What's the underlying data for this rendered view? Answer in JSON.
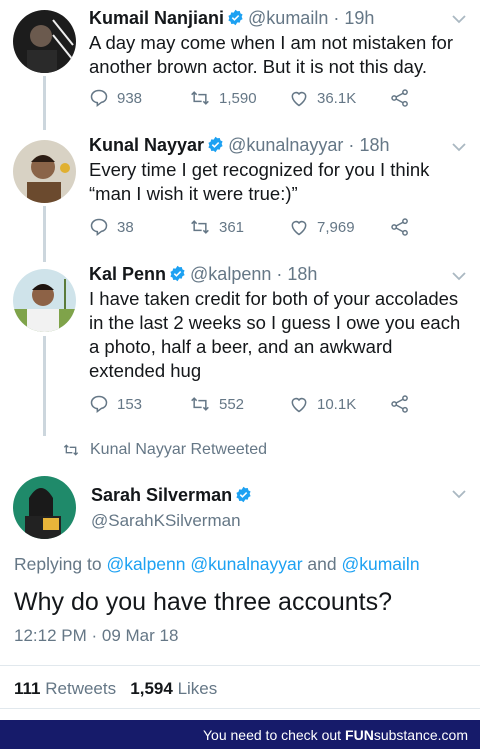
{
  "tweets": [
    {
      "name": "Kumail Nanjiani",
      "handle": "@kumailn",
      "sep": "·",
      "time": "19h",
      "text_lines": [
        "A day may come when I am not mistaken for",
        "another brown actor. But it is not this day."
      ],
      "replies": "938",
      "retweets": "1,590",
      "likes": "36.1K"
    },
    {
      "name": "Kunal Nayyar",
      "handle": "@kunalnayyar",
      "sep": "·",
      "time": "18h",
      "text_lines": [
        "Every time I get recognized for you I think",
        "“man I wish it were true:)”"
      ],
      "replies": "38",
      "retweets": "361",
      "likes": "7,969"
    },
    {
      "name": "Kal Penn",
      "handle": "@kalpenn",
      "sep": "·",
      "time": "18h",
      "text_lines": [
        "I have taken credit for both of your accolades",
        "in the last 2 weeks so I guess I owe you each",
        "a photo, half a beer, and an awkward",
        "extended hug"
      ],
      "replies": "153",
      "retweets": "552",
      "likes": "10.1K"
    }
  ],
  "retweeted_label": "Kunal Nayyar Retweeted",
  "main_tweet": {
    "name": "Sarah Silverman",
    "handle": "@SarahKSilverman",
    "replying_prefix": "Replying to",
    "replying_to": [
      "@kalpenn",
      "@kunalnayyar"
    ],
    "replying_and": "and",
    "replying_last": "@kumailn",
    "text": "Why do you have three accounts?",
    "timestamp": "12:12 PM · 09 Mar 18",
    "retweets_count": "111",
    "retweets_label": "Retweets",
    "likes_count": "1,594",
    "likes_label": "Likes"
  },
  "footer": {
    "text": "You need to check out",
    "brand_bold": "FUN",
    "brand_rest": "substance.com"
  },
  "colors": {
    "verified": "#1da1f2",
    "link": "#1da1f2",
    "muted": "#657786",
    "footer_bg": "#161b6a"
  }
}
